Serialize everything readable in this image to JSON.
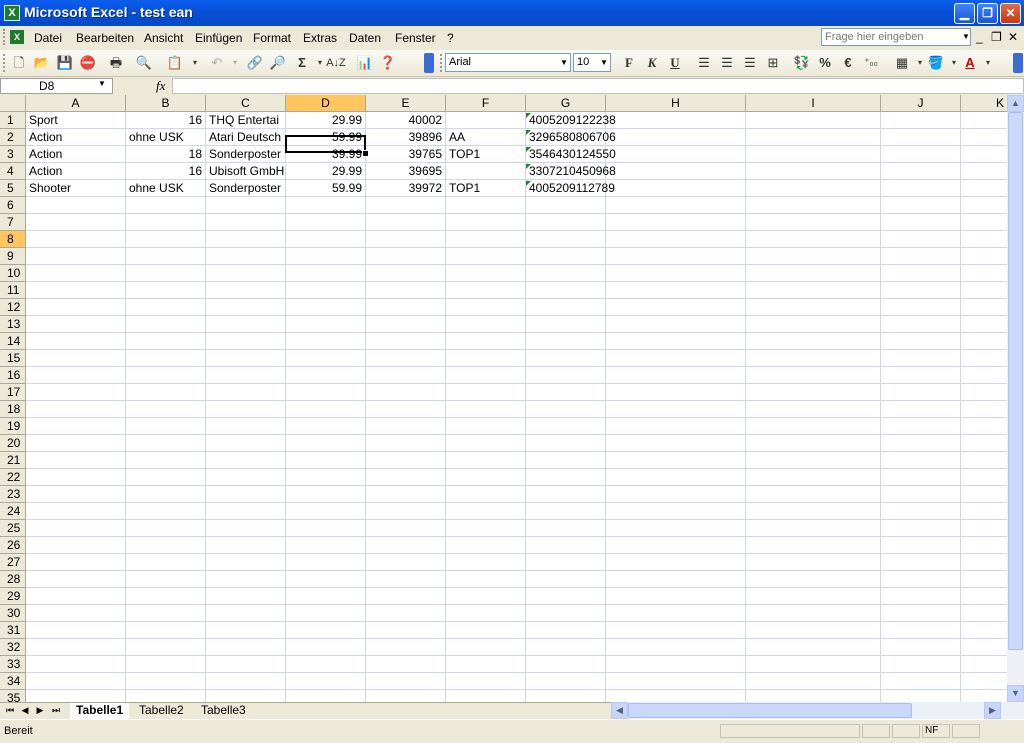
{
  "window": {
    "title": "Microsoft Excel - test ean",
    "app_icon": "excel-icon",
    "minimize": "minimize-icon",
    "maximize": "restore-icon",
    "close": "close-icon"
  },
  "menu": {
    "items": [
      "Datei",
      "Bearbeiten",
      "Ansicht",
      "Einfügen",
      "Format",
      "Extras",
      "Daten",
      "Fenster",
      "?"
    ],
    "help_placeholder": "Frage hier eingeben",
    "doc_controls": [
      "_",
      "❐",
      "✕"
    ]
  },
  "toolbar": {
    "font_name": "Arial",
    "font_size": "10",
    "bold": "F",
    "italic": "K",
    "underline": "U",
    "percent": "%",
    "euro": "€",
    "decimals": "⁺₀₀",
    "sum": "Σ"
  },
  "formula_bar": {
    "name_box": "D8",
    "fx": "fx",
    "value": ""
  },
  "grid": {
    "columns": [
      "A",
      "B",
      "C",
      "D",
      "E",
      "F",
      "G",
      "H",
      "I",
      "J",
      "K"
    ],
    "selected_column": "D",
    "rows": [
      "1",
      "2",
      "3",
      "4",
      "5",
      "6",
      "7",
      "8",
      "9",
      "10",
      "11",
      "12",
      "13",
      "14",
      "15",
      "16",
      "17",
      "18",
      "19",
      "20",
      "21",
      "22",
      "23",
      "24",
      "25",
      "26",
      "27",
      "28",
      "29",
      "30",
      "31",
      "32",
      "33",
      "34",
      "35"
    ],
    "selected_row": "8",
    "selected_cell": "D8",
    "data": [
      {
        "A": "Sport",
        "B": "16",
        "C": "THQ Entertai",
        "D": "29.99",
        "E": "40002",
        "F": "",
        "G": "4005209122238"
      },
      {
        "A": "Action",
        "B": "ohne USK",
        "C": "Atari Deutsch",
        "D": "59.99",
        "E": "39896",
        "F": "AA",
        "G": "3296580806706"
      },
      {
        "A": "Action",
        "B": "18",
        "C": "Sonderposter",
        "D": "39.99",
        "E": "39765",
        "F": "TOP1",
        "G": "3546430124550"
      },
      {
        "A": "Action",
        "B": "16",
        "C": "Ubisoft GmbH",
        "D": "29.99",
        "E": "39695",
        "F": "",
        "G": "3307210450968"
      },
      {
        "A": "Shooter",
        "B": "ohne USK",
        "C": "Sonderposter",
        "D": "59.99",
        "E": "39972",
        "F": "TOP1",
        "G": "4005209112789"
      }
    ]
  },
  "sheets": {
    "tabs": [
      "Tabelle1",
      "Tabelle2",
      "Tabelle3"
    ],
    "active": "Tabelle1"
  },
  "status": {
    "text": "Bereit",
    "indicator": "NF"
  }
}
